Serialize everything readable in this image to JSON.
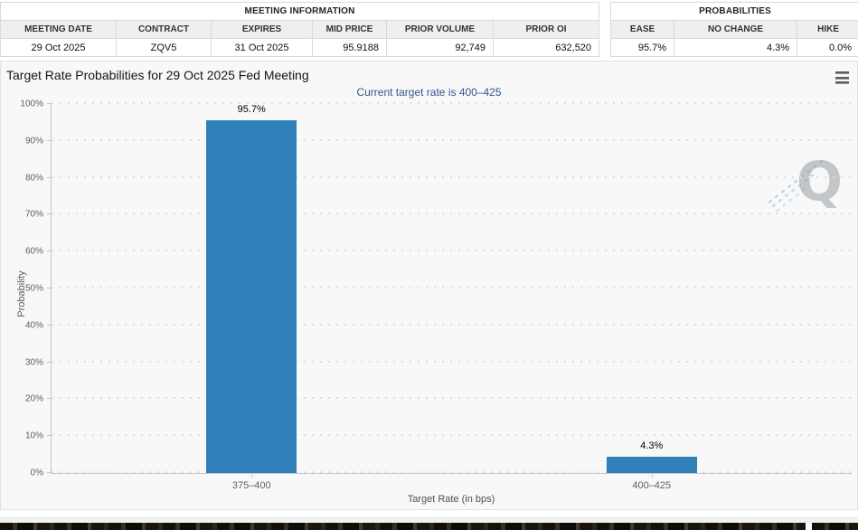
{
  "meeting_info_table": {
    "title": "MEETING INFORMATION",
    "columns": [
      "MEETING DATE",
      "CONTRACT",
      "EXPIRES",
      "MID PRICE",
      "PRIOR VOLUME",
      "PRIOR OI"
    ],
    "row": [
      "29 Oct 2025",
      "ZQV5",
      "31 Oct 2025",
      "95.9188",
      "92,749",
      "632,520"
    ]
  },
  "probabilities_table": {
    "title": "PROBABILITIES",
    "columns": [
      "EASE",
      "NO CHANGE",
      "HIKE"
    ],
    "row": [
      "95.7%",
      "4.3%",
      "0.0%"
    ]
  },
  "chart_data": {
    "type": "bar",
    "title": "Target Rate Probabilities for 29 Oct 2025 Fed Meeting",
    "subtitle": "Current target rate is 400–425",
    "categories": [
      "375–400",
      "400–425"
    ],
    "values": [
      95.7,
      4.3
    ],
    "data_labels": [
      "95.7%",
      "4.3%"
    ],
    "xlabel": "Target Rate (in bps)",
    "ylabel": "Probability",
    "ylim": [
      0,
      100
    ],
    "ytick_labels": [
      "0%",
      "10%",
      "20%",
      "30%",
      "40%",
      "50%",
      "60%",
      "70%",
      "80%",
      "90%",
      "100%"
    ],
    "grid": "dotted horizontal",
    "legend": "none",
    "bar_color": "#2f80b8",
    "subtitle_color": "#33568e"
  },
  "icons": {
    "menu": "hamburger-menu-icon",
    "watermark_letter": "Q"
  }
}
